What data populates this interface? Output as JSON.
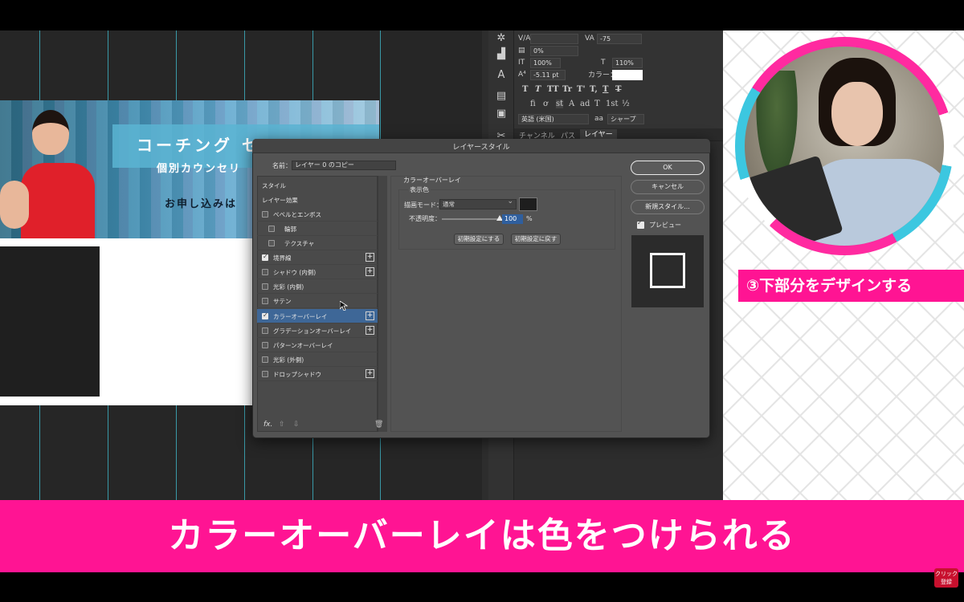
{
  "dialog": {
    "title": "レイヤースタイル",
    "name_label": "名前：",
    "name_value": "レイヤー 0 のコピー",
    "style_header": "スタイル",
    "effects_header": "レイヤー効果",
    "styles": [
      {
        "label": "ベベルとエンボス",
        "checked": false,
        "plus": false,
        "indent": false,
        "selected": false
      },
      {
        "label": "輪郭",
        "checked": false,
        "plus": false,
        "indent": true,
        "selected": false
      },
      {
        "label": "テクスチャ",
        "checked": false,
        "plus": false,
        "indent": true,
        "selected": false
      },
      {
        "label": "境界線",
        "checked": true,
        "plus": true,
        "indent": false,
        "selected": false
      },
      {
        "label": "シャドウ (内側)",
        "checked": false,
        "plus": true,
        "indent": false,
        "selected": false
      },
      {
        "label": "光彩 (内側)",
        "checked": false,
        "plus": false,
        "indent": false,
        "selected": false
      },
      {
        "label": "サテン",
        "checked": false,
        "plus": false,
        "indent": false,
        "selected": false
      },
      {
        "label": "カラーオーバーレイ",
        "checked": true,
        "plus": true,
        "indent": false,
        "selected": true
      },
      {
        "label": "グラデーションオーバーレイ",
        "checked": false,
        "plus": true,
        "indent": false,
        "selected": false
      },
      {
        "label": "パターンオーバーレイ",
        "checked": false,
        "plus": false,
        "indent": false,
        "selected": false
      },
      {
        "label": "光彩 (外側)",
        "checked": false,
        "plus": false,
        "indent": false,
        "selected": false
      },
      {
        "label": "ドロップシャドウ",
        "checked": false,
        "plus": true,
        "indent": false,
        "selected": false
      }
    ],
    "footer_fx": "fx.",
    "section_title": "カラーオーバーレイ",
    "group_title": "表示色",
    "blend_label": "描画モード：",
    "blend_value": "通常",
    "opacity_label": "不透明度：",
    "opacity_value": "100",
    "opacity_unit": "%",
    "opacity_fraction": 1.0,
    "swatch_color": "#1e1e1e",
    "btn_make_default": "初期設定にする",
    "btn_reset_default": "初期設定に戻す",
    "ok_label": "OK",
    "cancel_label": "キャンセル",
    "new_style_label": "新規スタイル...",
    "preview_label": "プレビュー",
    "preview_checked": true
  },
  "char_panel": {
    "tracking_value": "-75",
    "scale_pct": "0%",
    "vscale": "100%",
    "hscale": "110%",
    "baseline": "-5.11 pt",
    "color_label": "カラー：",
    "language": "英語 (米国)",
    "antialias": "シャープ",
    "style_glyphs": [
      "T",
      "T",
      "TT",
      "Tr",
      "T'",
      "T,",
      "T",
      "T"
    ],
    "ot_glyphs": [
      "fi",
      "ơ",
      "st",
      "A",
      "ad",
      "T",
      "1st",
      "½"
    ]
  },
  "layer_tabs": [
    "チャンネル",
    "パス",
    "レイヤー"
  ],
  "banner": {
    "title": "コーチング セ",
    "subtitle": "個別カウンセリ",
    "apply": "お申し込みは"
  },
  "step_label": "③下部分をデザインする",
  "subtitle": "カラーオーバーレイは色をつけられる",
  "subscribe": {
    "line1": "クリック",
    "line2": "登録"
  },
  "colors": {
    "accent_pink": "#ff1493",
    "guide_cyan": "#3fb6c8",
    "dialog_bg": "#535353",
    "selected_row": "#3e6797"
  }
}
